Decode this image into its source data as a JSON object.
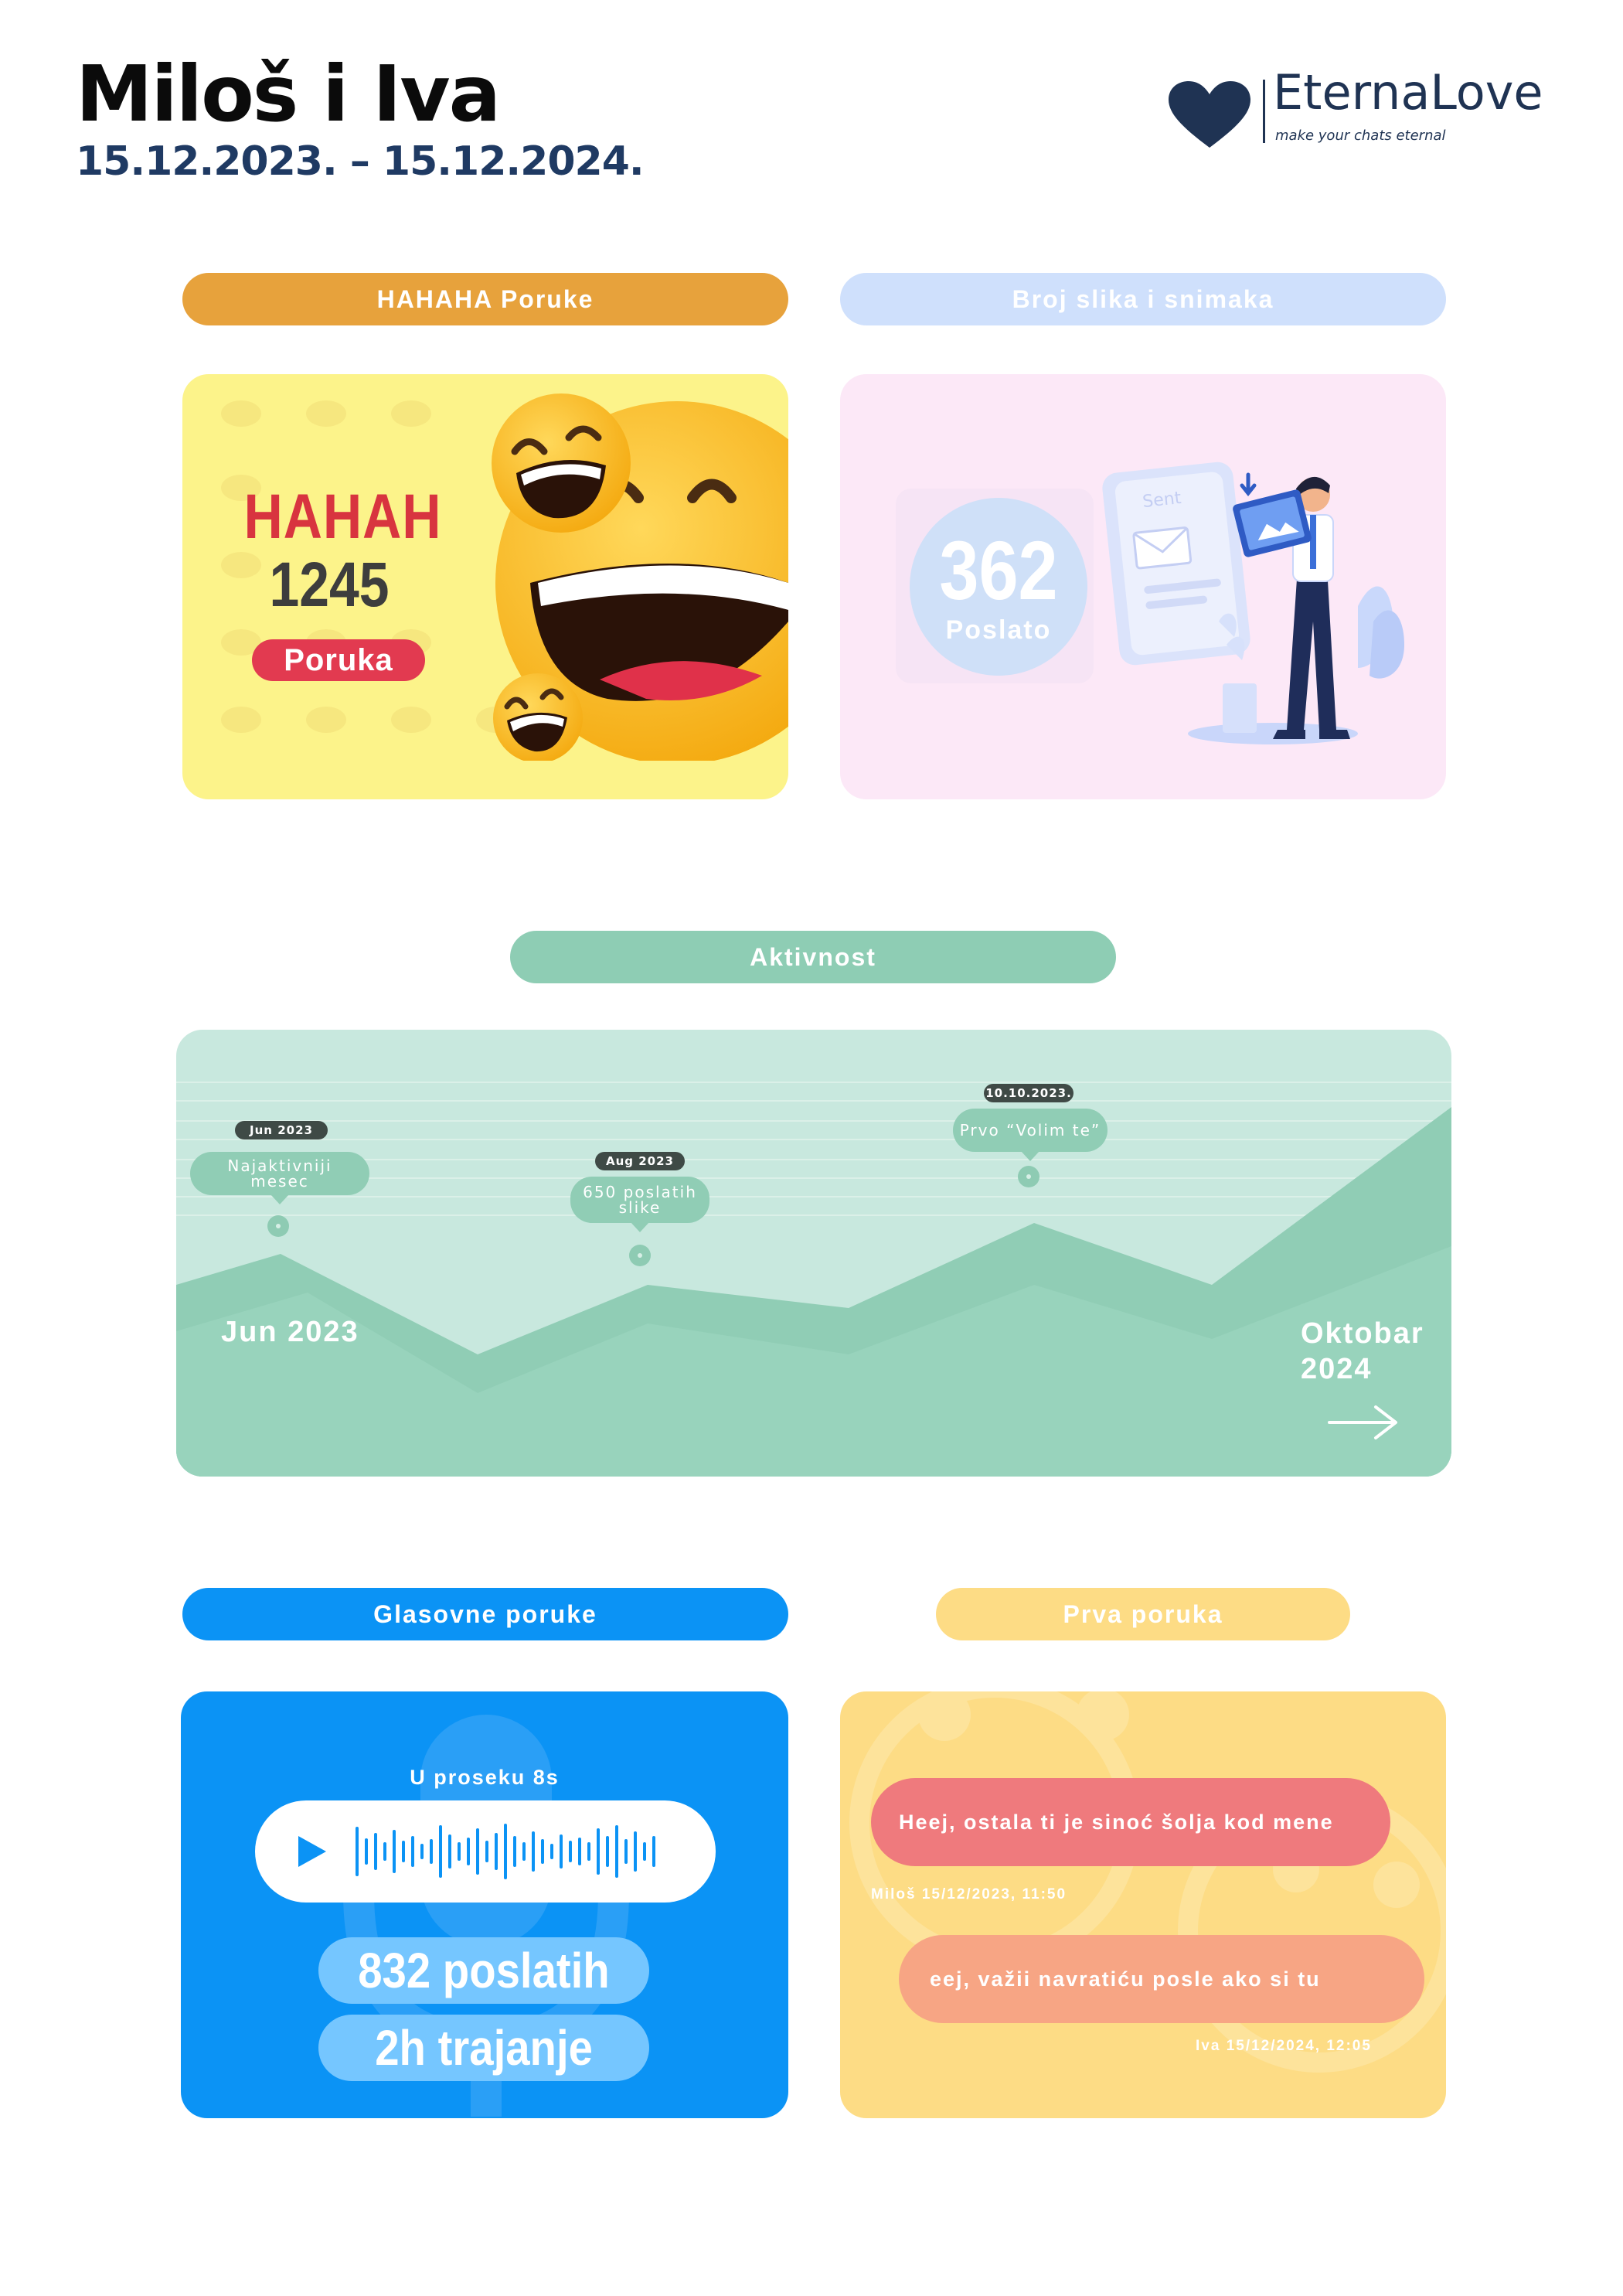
{
  "header": {
    "title": "Miloš i Iva",
    "dates": "15.12.2023. – 15.12.2024."
  },
  "logo": {
    "brand": "EternaLove",
    "tagline": "make your chats eternal",
    "icon": "heart-icon"
  },
  "haha": {
    "pill_label": "HAHAHA Poruke",
    "word": "HAHAH",
    "count": "1245",
    "label": "Poruka",
    "colors": {
      "pill": "#e7a23c",
      "card": "#fcf38a",
      "accent": "#e23a50"
    }
  },
  "slike": {
    "pill_label": "Broj slika i snimaka",
    "count": "362",
    "label": "Poslato",
    "illustration_text": "Sent",
    "colors": {
      "pill": "#cfe0fc",
      "card": "#fce8f7"
    }
  },
  "activity": {
    "pill_label": "Aktivnost",
    "start_label": "Jun 2023",
    "end_label": "Oktobar 2024",
    "markers": [
      {
        "date": "Jun 2023",
        "text": "Najaktivniji mesec"
      },
      {
        "date": "Aug 2023",
        "text": "650 poslatih slike"
      },
      {
        "date": "10.10.2023.",
        "text": "Prvo “Volim te”"
      }
    ],
    "colors": {
      "pill": "#8ecdb4",
      "card": "#c8e8de",
      "area_back": "#90cdb5",
      "area_front": "#98d3bc"
    }
  },
  "voice": {
    "pill_label": "Glasovne poruke",
    "average": "U proseku 8s",
    "sent": "832 poslatih",
    "duration": "2h trajanje",
    "icons": {
      "play": "play-icon",
      "wave": "waveform-icon"
    },
    "colors": {
      "pill": "#0b93f5",
      "card": "#0b93f5",
      "badge": "#75c6ff"
    }
  },
  "first": {
    "pill_label": "Prva poruka",
    "messages": [
      {
        "text": "Heej, ostala ti je sinoć šolja kod mene",
        "meta": "Miloš 15/12/2023, 11:50"
      },
      {
        "text": "eej, važii navratiću posle ako si tu",
        "meta": "Iva 15/12/2024, 12:05"
      }
    ],
    "colors": {
      "pill": "#fddc85",
      "card": "#fddc85"
    }
  }
}
